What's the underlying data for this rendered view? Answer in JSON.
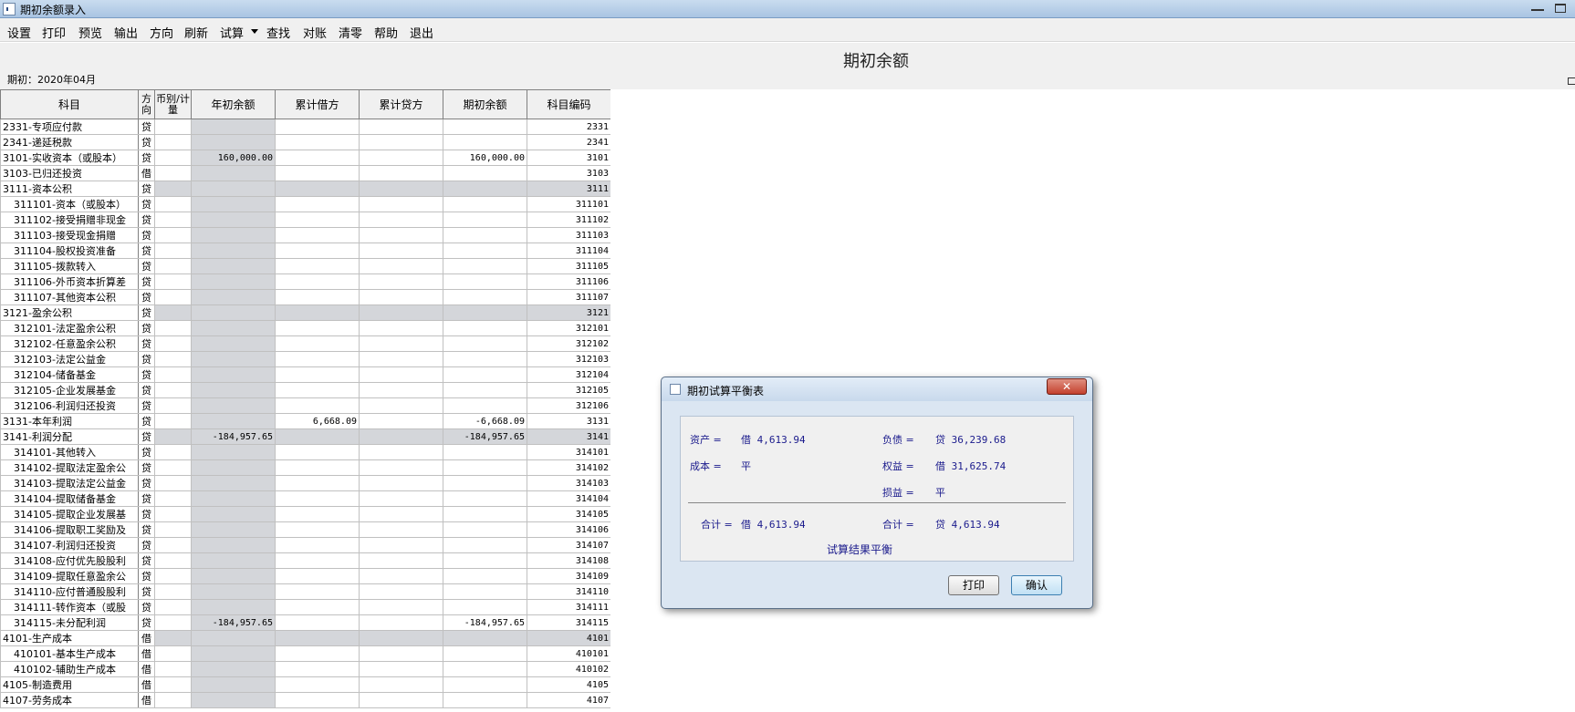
{
  "window": {
    "title": "期初余额录入"
  },
  "menu": [
    "设置",
    "打印",
    "预览",
    "输出",
    "方向",
    "刷新",
    "试算",
    "查找",
    "对账",
    "清零",
    "帮助",
    "退出"
  ],
  "header": {
    "title": "期初余额",
    "period": "期初：2020年04月"
  },
  "grid": {
    "columns": [
      "科目",
      "方向",
      "币别/计量",
      "年初余额",
      "累计借方",
      "累计贷方",
      "期初余额",
      "科目编码"
    ],
    "rows": [
      {
        "subject": "2331-专项应付款",
        "dir": "贷",
        "opening": "",
        "debit": "",
        "credit": "",
        "beginning": "",
        "code": "2331",
        "level": 1,
        "parent": false
      },
      {
        "subject": "2341-递延税款",
        "dir": "贷",
        "opening": "",
        "debit": "",
        "credit": "",
        "beginning": "",
        "code": "2341",
        "level": 1,
        "parent": false
      },
      {
        "subject": "3101-实收资本（或股本）",
        "dir": "贷",
        "opening": "160,000.00",
        "debit": "",
        "credit": "",
        "beginning": "160,000.00",
        "code": "3101",
        "level": 1,
        "parent": false
      },
      {
        "subject": "3103-已归还投资",
        "dir": "借",
        "opening": "",
        "debit": "",
        "credit": "",
        "beginning": "",
        "code": "3103",
        "level": 1,
        "parent": false
      },
      {
        "subject": "3111-资本公积",
        "dir": "贷",
        "opening": "",
        "debit": "",
        "credit": "",
        "beginning": "",
        "code": "3111",
        "level": 1,
        "parent": true
      },
      {
        "subject": "311101-资本（或股本）",
        "dir": "贷",
        "opening": "",
        "debit": "",
        "credit": "",
        "beginning": "",
        "code": "311101",
        "level": 2,
        "parent": false
      },
      {
        "subject": "311102-接受捐赠非现金",
        "dir": "贷",
        "opening": "",
        "debit": "",
        "credit": "",
        "beginning": "",
        "code": "311102",
        "level": 2,
        "parent": false
      },
      {
        "subject": "311103-接受现金捐赠",
        "dir": "贷",
        "opening": "",
        "debit": "",
        "credit": "",
        "beginning": "",
        "code": "311103",
        "level": 2,
        "parent": false
      },
      {
        "subject": "311104-股权投资准备",
        "dir": "贷",
        "opening": "",
        "debit": "",
        "credit": "",
        "beginning": "",
        "code": "311104",
        "level": 2,
        "parent": false
      },
      {
        "subject": "311105-拨款转入",
        "dir": "贷",
        "opening": "",
        "debit": "",
        "credit": "",
        "beginning": "",
        "code": "311105",
        "level": 2,
        "parent": false
      },
      {
        "subject": "311106-外币资本折算差",
        "dir": "贷",
        "opening": "",
        "debit": "",
        "credit": "",
        "beginning": "",
        "code": "311106",
        "level": 2,
        "parent": false
      },
      {
        "subject": "311107-其他资本公积",
        "dir": "贷",
        "opening": "",
        "debit": "",
        "credit": "",
        "beginning": "",
        "code": "311107",
        "level": 2,
        "parent": false
      },
      {
        "subject": "3121-盈余公积",
        "dir": "贷",
        "opening": "",
        "debit": "",
        "credit": "",
        "beginning": "",
        "code": "3121",
        "level": 1,
        "parent": true
      },
      {
        "subject": "312101-法定盈余公积",
        "dir": "贷",
        "opening": "",
        "debit": "",
        "credit": "",
        "beginning": "",
        "code": "312101",
        "level": 2,
        "parent": false
      },
      {
        "subject": "312102-任意盈余公积",
        "dir": "贷",
        "opening": "",
        "debit": "",
        "credit": "",
        "beginning": "",
        "code": "312102",
        "level": 2,
        "parent": false
      },
      {
        "subject": "312103-法定公益金",
        "dir": "贷",
        "opening": "",
        "debit": "",
        "credit": "",
        "beginning": "",
        "code": "312103",
        "level": 2,
        "parent": false
      },
      {
        "subject": "312104-储备基金",
        "dir": "贷",
        "opening": "",
        "debit": "",
        "credit": "",
        "beginning": "",
        "code": "312104",
        "level": 2,
        "parent": false
      },
      {
        "subject": "312105-企业发展基金",
        "dir": "贷",
        "opening": "",
        "debit": "",
        "credit": "",
        "beginning": "",
        "code": "312105",
        "level": 2,
        "parent": false
      },
      {
        "subject": "312106-利润归还投资",
        "dir": "贷",
        "opening": "",
        "debit": "",
        "credit": "",
        "beginning": "",
        "code": "312106",
        "level": 2,
        "parent": false
      },
      {
        "subject": "3131-本年利润",
        "dir": "贷",
        "opening": "",
        "debit": "6,668.09",
        "credit": "",
        "beginning": "-6,668.09",
        "code": "3131",
        "level": 1,
        "parent": false
      },
      {
        "subject": "3141-利润分配",
        "dir": "贷",
        "opening": "-184,957.65",
        "debit": "",
        "credit": "",
        "beginning": "-184,957.65",
        "code": "3141",
        "level": 1,
        "parent": true
      },
      {
        "subject": "314101-其他转入",
        "dir": "贷",
        "opening": "",
        "debit": "",
        "credit": "",
        "beginning": "",
        "code": "314101",
        "level": 2,
        "parent": false
      },
      {
        "subject": "314102-提取法定盈余公",
        "dir": "贷",
        "opening": "",
        "debit": "",
        "credit": "",
        "beginning": "",
        "code": "314102",
        "level": 2,
        "parent": false
      },
      {
        "subject": "314103-提取法定公益金",
        "dir": "贷",
        "opening": "",
        "debit": "",
        "credit": "",
        "beginning": "",
        "code": "314103",
        "level": 2,
        "parent": false
      },
      {
        "subject": "314104-提取储备基金",
        "dir": "贷",
        "opening": "",
        "debit": "",
        "credit": "",
        "beginning": "",
        "code": "314104",
        "level": 2,
        "parent": false
      },
      {
        "subject": "314105-提取企业发展基",
        "dir": "贷",
        "opening": "",
        "debit": "",
        "credit": "",
        "beginning": "",
        "code": "314105",
        "level": 2,
        "parent": false
      },
      {
        "subject": "314106-提取职工奖励及",
        "dir": "贷",
        "opening": "",
        "debit": "",
        "credit": "",
        "beginning": "",
        "code": "314106",
        "level": 2,
        "parent": false
      },
      {
        "subject": "314107-利润归还投资",
        "dir": "贷",
        "opening": "",
        "debit": "",
        "credit": "",
        "beginning": "",
        "code": "314107",
        "level": 2,
        "parent": false
      },
      {
        "subject": "314108-应付优先股股利",
        "dir": "贷",
        "opening": "",
        "debit": "",
        "credit": "",
        "beginning": "",
        "code": "314108",
        "level": 2,
        "parent": false
      },
      {
        "subject": "314109-提取任意盈余公",
        "dir": "贷",
        "opening": "",
        "debit": "",
        "credit": "",
        "beginning": "",
        "code": "314109",
        "level": 2,
        "parent": false
      },
      {
        "subject": "314110-应付普通股股利",
        "dir": "贷",
        "opening": "",
        "debit": "",
        "credit": "",
        "beginning": "",
        "code": "314110",
        "level": 2,
        "parent": false
      },
      {
        "subject": "314111-转作资本（或股",
        "dir": "贷",
        "opening": "",
        "debit": "",
        "credit": "",
        "beginning": "",
        "code": "314111",
        "level": 2,
        "parent": false
      },
      {
        "subject": "314115-未分配利润",
        "dir": "贷",
        "opening": "-184,957.65",
        "debit": "",
        "credit": "",
        "beginning": "-184,957.65",
        "code": "314115",
        "level": 2,
        "parent": false
      },
      {
        "subject": "4101-生产成本",
        "dir": "借",
        "opening": "",
        "debit": "",
        "credit": "",
        "beginning": "",
        "code": "4101",
        "level": 1,
        "parent": true
      },
      {
        "subject": "410101-基本生产成本",
        "dir": "借",
        "opening": "",
        "debit": "",
        "credit": "",
        "beginning": "",
        "code": "410101",
        "level": 2,
        "parent": false
      },
      {
        "subject": "410102-辅助生产成本",
        "dir": "借",
        "opening": "",
        "debit": "",
        "credit": "",
        "beginning": "",
        "code": "410102",
        "level": 2,
        "parent": false
      },
      {
        "subject": "4105-制造费用",
        "dir": "借",
        "opening": "",
        "debit": "",
        "credit": "",
        "beginning": "",
        "code": "4105",
        "level": 1,
        "parent": false
      },
      {
        "subject": "4107-劳务成本",
        "dir": "借",
        "opening": "",
        "debit": "",
        "credit": "",
        "beginning": "",
        "code": "4107",
        "level": 1,
        "parent": false
      }
    ]
  },
  "dialog": {
    "title": "期初试算平衡表",
    "close_label": "✕",
    "assets_label": "资产 =",
    "assets_value": "借 4,613.94",
    "liabilities_label": "负债 =",
    "liabilities_value": "贷 36,239.68",
    "cost_label": "成本 =",
    "cost_value": "平",
    "equity_label": "权益 =",
    "equity_value": "借 31,625.74",
    "pnl_label": "损益 =",
    "pnl_value": "平",
    "total_left_label": "合计 =",
    "total_left_value": "借 4,613.94",
    "total_right_label": "合计 =",
    "total_right_value": "贷 4,613.94",
    "result": "试算结果平衡",
    "print_button": "打印",
    "confirm_button": "确认"
  }
}
